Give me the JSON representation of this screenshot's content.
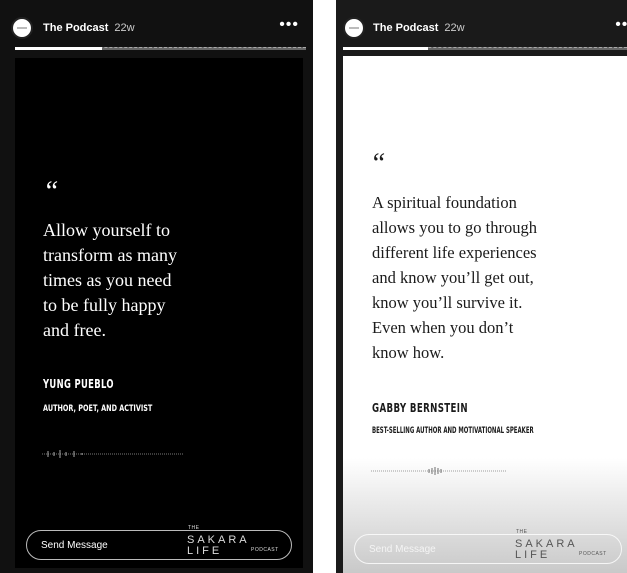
{
  "stories": {
    "left": {
      "account_name": "The Podcast",
      "time_ago": "22w",
      "more_label": "•••",
      "progress_fraction": 0.3,
      "quote_mark": "“",
      "quote": "Allow yourself to\ntransform as many\ntimes as you need\nto be fully happy\nand free.",
      "author": "YUNG PUEBLO",
      "role": "AUTHOR, POET, AND ACTIVIST",
      "message_placeholder": "Send Message",
      "logo": {
        "top": "THE",
        "main": "SAKARA LIFE",
        "bottom": "PODCAST"
      }
    },
    "right": {
      "account_name": "The Podcast",
      "time_ago": "22w",
      "more_label": "•••",
      "progress_fraction": 0.3,
      "quote_mark": "“",
      "quote": "A spiritual foundation\nallows you to go through\ndifferent life experiences\nand know you’ll get out,\nknow you’ll survive it.\nEven when you don’t\nknow how.",
      "author": "GABBY BERNSTEIN",
      "role": "BEST-SELLING AUTHOR AND MOTIVATIONAL SPEAKER",
      "message_placeholder": "Send Message",
      "logo": {
        "top": "THE",
        "main": "SAKARA LIFE",
        "bottom": "PODCAST"
      }
    }
  },
  "colors": {
    "dark_card": "#000000",
    "light_card": "#ffffff",
    "text_light": "#ffffff",
    "text_dark": "#1b1b1b"
  }
}
